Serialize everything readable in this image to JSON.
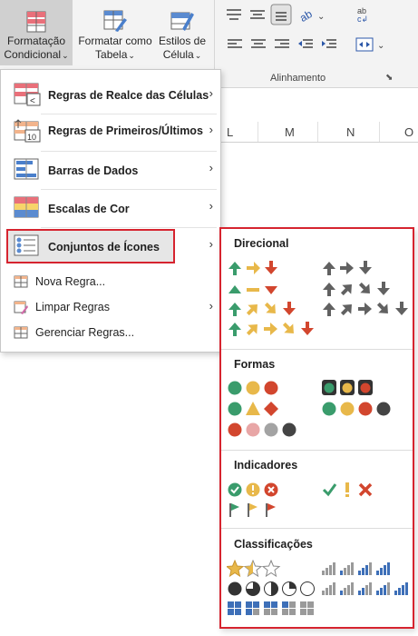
{
  "ribbon": {
    "cond_format": {
      "line1": "Formatação",
      "line2": "Condicional"
    },
    "format_table": {
      "line1": "Formatar como",
      "line2": "Tabela"
    },
    "cell_styles": {
      "line1": "Estilos de",
      "line2": "Célula"
    },
    "alignment_group": "Alinhamento"
  },
  "columns": [
    "L",
    "M",
    "N",
    "O"
  ],
  "menu": {
    "items": [
      {
        "label": "Regras de Realce das Células",
        "icon": "highlight-cells-icon"
      },
      {
        "label": "Regras de Primeiros/Últimos",
        "icon": "top-bottom-icon"
      },
      {
        "label": "Barras de Dados",
        "icon": "data-bars-icon"
      },
      {
        "label": "Escalas de Cor",
        "icon": "color-scales-icon"
      },
      {
        "label": "Conjuntos de Ícones",
        "icon": "icon-sets-icon"
      },
      {
        "label": "Nova Regra...",
        "icon": "new-rule-icon"
      },
      {
        "label": "Limpar Regras",
        "icon": "clear-rules-icon"
      },
      {
        "label": "Gerenciar Regras...",
        "icon": "manage-rules-icon"
      }
    ]
  },
  "submenu": {
    "sections": [
      "Direcional",
      "Formas",
      "Indicadores",
      "Classificações"
    ]
  },
  "colors": {
    "green": "#3a9c6c",
    "yellow": "#e8b84a",
    "red": "#d2462e",
    "gray": "#616161",
    "highlight_border": "#d6242f"
  }
}
